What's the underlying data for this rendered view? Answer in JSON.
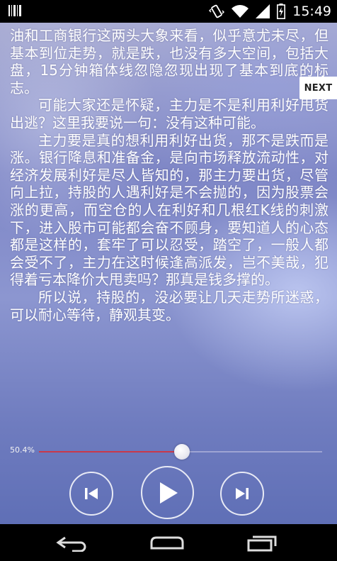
{
  "status_bar": {
    "time": "15:49",
    "icons": [
      "barcode-notification-icon",
      "vibrate-icon",
      "wifi-icon",
      "signal-icon",
      "battery-charging-icon"
    ]
  },
  "article": {
    "paragraphs": [
      "油和工商银行这两头大象来看，似乎意尤未尽，但基本到位走势，就是跌，也没有多大空间，包括大盘，15分钟箱体线忽隐忽现出现了基本到底的标志。",
      "可能大家还是怀疑，主力是不是利用利好甩货出逃？这里我要说一句：没有这种可能。",
      "主力要是真的想利用利好出货，那不是跌而是涨。银行降息和准备金，是向市场释放流动性，对经济发展利好是尽人皆知的，那主力要出货，尽管向上拉，持股的人遇利好是不会抛的，因为股票会涨的更高，而空仓的人在利好和几根红K线的刺激下，进入股市可能都会奋不顾身，要知道人的心态都是这样的，套牢了可以忍受，踏空了，一般人都会受不了，主力在这时候逢高派发，岂不美哉，犯得着亏本降价大甩卖吗？那真是钱多撑的。",
      "所以说，持股的，没必要让几天走势所迷惑，可以耐心等待，静观其变。"
    ]
  },
  "next_button": {
    "label": "NEXT"
  },
  "player": {
    "progress_label": "50.4%",
    "progress": 0.504,
    "prev_icon": "skip-previous-icon",
    "play_icon": "play-icon",
    "next_icon": "skip-next-icon",
    "progress_color": "#c9394a"
  },
  "nav_bar": {
    "icons": [
      "back-icon",
      "home-icon",
      "recent-apps-icon"
    ]
  }
}
